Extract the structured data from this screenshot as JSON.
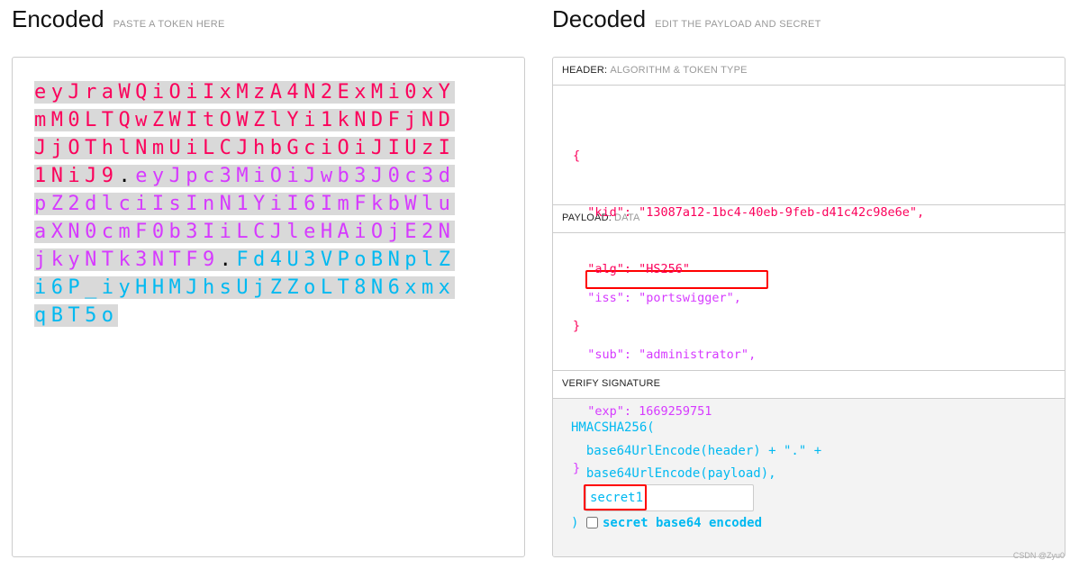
{
  "encoded": {
    "title": "Encoded",
    "subtitle": "PASTE A TOKEN HERE",
    "token": {
      "header": "eyJraWQiOiIxMzA4N2ExMi0xYmM0LTQwZWItOWZlYi1kNDFjNDJjOThlNmUiLCJhbGciOiJIUzI1NiJ9",
      "dot": ".",
      "payload": "eyJpc3MiOiJwb3J0c3dpZ2dlciIsInN1YiI6ImFkbWluaXN0cmF0b3IiLCJleHAiOjE2NjkyNTk3NTF9",
      "signature": "Fd4U3VPoBNplZi6P_iyHHMJhsUjZZoLT8N6xmxqBT5o"
    }
  },
  "decoded": {
    "title": "Decoded",
    "subtitle": "EDIT THE PAYLOAD AND SECRET",
    "header_section": {
      "label": "HEADER:",
      "sub": "ALGORITHM & TOKEN TYPE",
      "lines": [
        "{",
        "  \"kid\": \"13087a12-1bc4-40eb-9feb-d41c42c98e6e\",",
        "  \"alg\": \"HS256\"",
        "}"
      ]
    },
    "payload_section": {
      "label": "PAYLOAD:",
      "sub": "DATA",
      "lines": [
        "  \"iss\": \"portswigger\",",
        "  \"sub\": \"administrator\",",
        "  \"exp\": 1669259751",
        "}"
      ]
    },
    "signature_section": {
      "label": "VERIFY SIGNATURE",
      "line1": "HMACSHA256(",
      "line2": "  base64UrlEncode(header) + \".\" +",
      "line3": "  base64UrlEncode(payload),",
      "secret": "secret1",
      "close": ")",
      "checkbox_label": "secret base64 encoded",
      "checkbox_checked": false
    }
  },
  "watermark": "CSDN @Zyu0"
}
